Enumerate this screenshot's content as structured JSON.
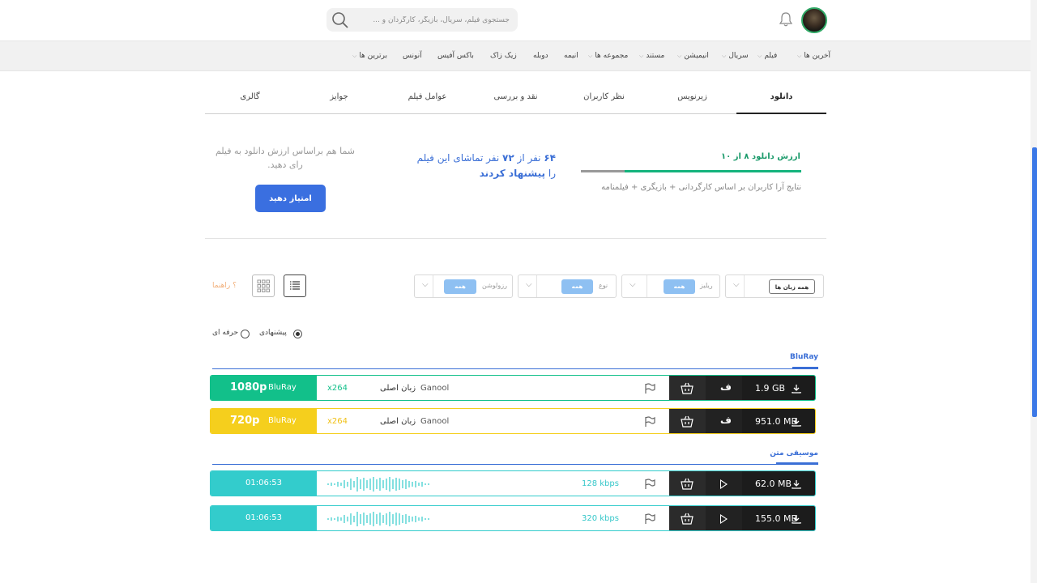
{
  "header": {
    "search_placeholder": "جستجوی فیلم، سریال، بازیگر، کارگردان و ...",
    "icons": [
      "search-icon",
      "bell-icon",
      "avatar"
    ]
  },
  "nav": {
    "items": [
      {
        "label": "آخرین ها",
        "dropdown": true
      },
      {
        "label": "فیلم",
        "dropdown": true
      },
      {
        "label": "سریال",
        "dropdown": true
      },
      {
        "label": "انیمیشن",
        "dropdown": true
      },
      {
        "label": "مستند",
        "dropdown": true
      },
      {
        "label": "مجموعه ها",
        "dropdown": true
      },
      {
        "label": "انیمه",
        "dropdown": false
      },
      {
        "label": "دوبله",
        "dropdown": false
      },
      {
        "label": "زیک زاک",
        "dropdown": false
      },
      {
        "label": "باکس آفیس",
        "dropdown": false
      },
      {
        "label": "آنونس",
        "dropdown": false
      },
      {
        "label": "برترین ها",
        "dropdown": true
      }
    ]
  },
  "tabs": [
    {
      "label": "دانلود",
      "active": true
    },
    {
      "label": "زیرنویس",
      "active": false
    },
    {
      "label": "نظر کاربران",
      "active": false
    },
    {
      "label": "نقد و بررسی",
      "active": false
    },
    {
      "label": "عوامل فیلم",
      "active": false
    },
    {
      "label": "جوایز",
      "active": false
    },
    {
      "label": "گالری",
      "active": false
    }
  ],
  "rating": {
    "title": "ارزش دانلود ۸ از ۱۰",
    "score": 8,
    "max": 10,
    "subtitle": "نتایج آرا کاربران بر اساس کارگردانی + بازیگری + فیلمنامه",
    "suggest_count": "۶۴",
    "suggest_total": "۷۲",
    "suggest_text_1": "نفر از",
    "suggest_text_2": "نفر تماشای این فیلم",
    "suggest_text_3": "را",
    "suggest_strong": "پیشنهاد کردند",
    "prompt": "شما هم براساس ارزش دانلود به فیلم رای دهید.",
    "button": "امتیاز دهید"
  },
  "filters": {
    "language": {
      "value": "همه زبان ها"
    },
    "release": {
      "label": "ریلیز",
      "value": "همه"
    },
    "type": {
      "label": "نوع",
      "value": "همه"
    },
    "resolution": {
      "label": "رزولوشن",
      "value": "همه"
    },
    "help": "راهنما"
  },
  "mode": {
    "options": [
      {
        "label": "پیشنهادی",
        "checked": true
      },
      {
        "label": "حرفه ای",
        "checked": false
      }
    ]
  },
  "sections": {
    "bluray": {
      "title": "BluRay",
      "rows": [
        {
          "quality": "1080p",
          "source": "BluRay",
          "codec": "x264",
          "language": "زبان اصلی",
          "release": "Ganool",
          "sub": "ف",
          "size": "1.9 GB",
          "color": "#12c08a"
        },
        {
          "quality": "720p",
          "source": "BluRay",
          "codec": "x264",
          "language": "زبان اصلی",
          "release": "Ganool",
          "sub": "ف",
          "size": "951.0 MB",
          "color": "#f5cf1d"
        }
      ]
    },
    "music": {
      "title": "موسیقی متن",
      "rows": [
        {
          "duration": "01:06:53",
          "bitrate": "128 kbps",
          "size": "62.0 MB"
        },
        {
          "duration": "01:06:53",
          "bitrate": "320 kbps",
          "size": "155.0 MB"
        }
      ],
      "color": "#33cccc"
    }
  }
}
